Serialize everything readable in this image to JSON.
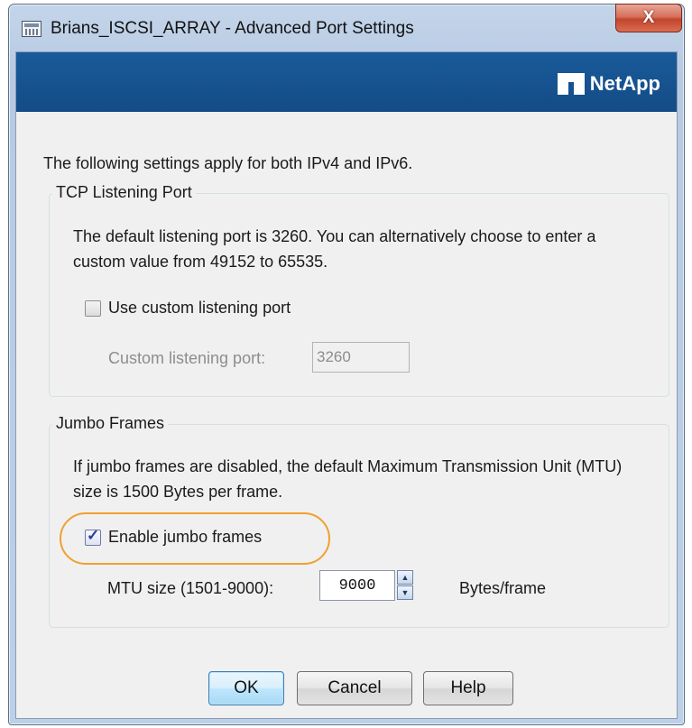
{
  "window": {
    "title": "Brians_ISCSI_ARRAY - Advanced Port Settings",
    "close_label": "X"
  },
  "banner": {
    "brand": "NetApp",
    "brand_color": "#1a5a9a"
  },
  "intro_text": "The following settings apply for both IPv4 and IPv6.",
  "tcp_group": {
    "title": "TCP Listening Port",
    "description": "The default listening port is 3260. You can alternatively choose to enter a custom value from 49152 to 65535.",
    "custom_checkbox": {
      "label": "Use custom listening port",
      "checked": false
    },
    "port_label": "Custom listening port:",
    "port_value": "3260"
  },
  "jumbo_group": {
    "title": "Jumbo Frames",
    "description": "If jumbo frames are disabled, the default Maximum Transmission Unit (MTU) size is 1500 Bytes per frame.",
    "enable_checkbox": {
      "label": "Enable jumbo frames",
      "checked": true
    },
    "mtu_label": "MTU size (1501-9000):",
    "mtu_value": "9000",
    "unit_label": "Bytes/frame"
  },
  "buttons": {
    "ok": "OK",
    "cancel": "Cancel",
    "help": "Help"
  },
  "icons": {
    "window_icon": "app-window-icon",
    "close": "close-icon",
    "spin_up": "spin-up-icon",
    "spin_down": "spin-down-icon",
    "check": "checkmark-icon"
  },
  "colors": {
    "highlight": "#f0a030"
  }
}
